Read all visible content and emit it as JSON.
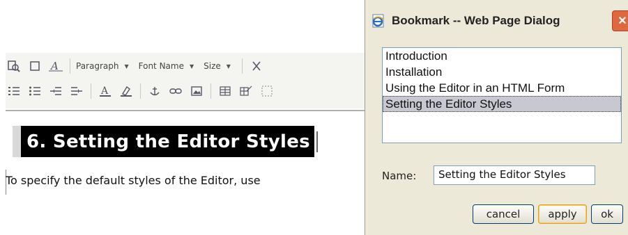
{
  "editor": {
    "toolbar": {
      "row1": {
        "icons": [
          "find-icon",
          "select-all-icon",
          "text-style-icon"
        ],
        "paragraph_label": "Paragraph",
        "font_name_label": "Font Name",
        "size_label": "Size",
        "cut_icon": "cut-icon"
      },
      "row2": {
        "icons": [
          "numbered-list-icon",
          "bulleted-list-icon",
          "indent-icon",
          "outdent-icon",
          "font-color-icon",
          "highlight-icon",
          "anchor-icon",
          "link-icon",
          "image-icon",
          "table-icon",
          "edit-table-icon",
          "form-icon"
        ]
      }
    },
    "heading": "6. Setting the Editor Styles",
    "paragraph": "To specify the default styles of the Editor, use"
  },
  "dialog": {
    "title": "Bookmark -- Web Page Dialog",
    "bookmarks": [
      "Introduction",
      "Installation",
      "Using the Editor in an HTML Form",
      "Setting the Editor Styles"
    ],
    "selected_bookmark": "Setting the Editor Styles",
    "name_label": "Name:",
    "name_value": "Setting the Editor Styles",
    "cancel_label": "cancel",
    "apply_label": "apply",
    "ok_label": "ok",
    "close_glyph": "✕"
  },
  "colors": {
    "heading_bg": "#000000",
    "selection": "#c8c8d0",
    "dialog_bg": "#ece9d8",
    "close_button": "#e0683e"
  }
}
